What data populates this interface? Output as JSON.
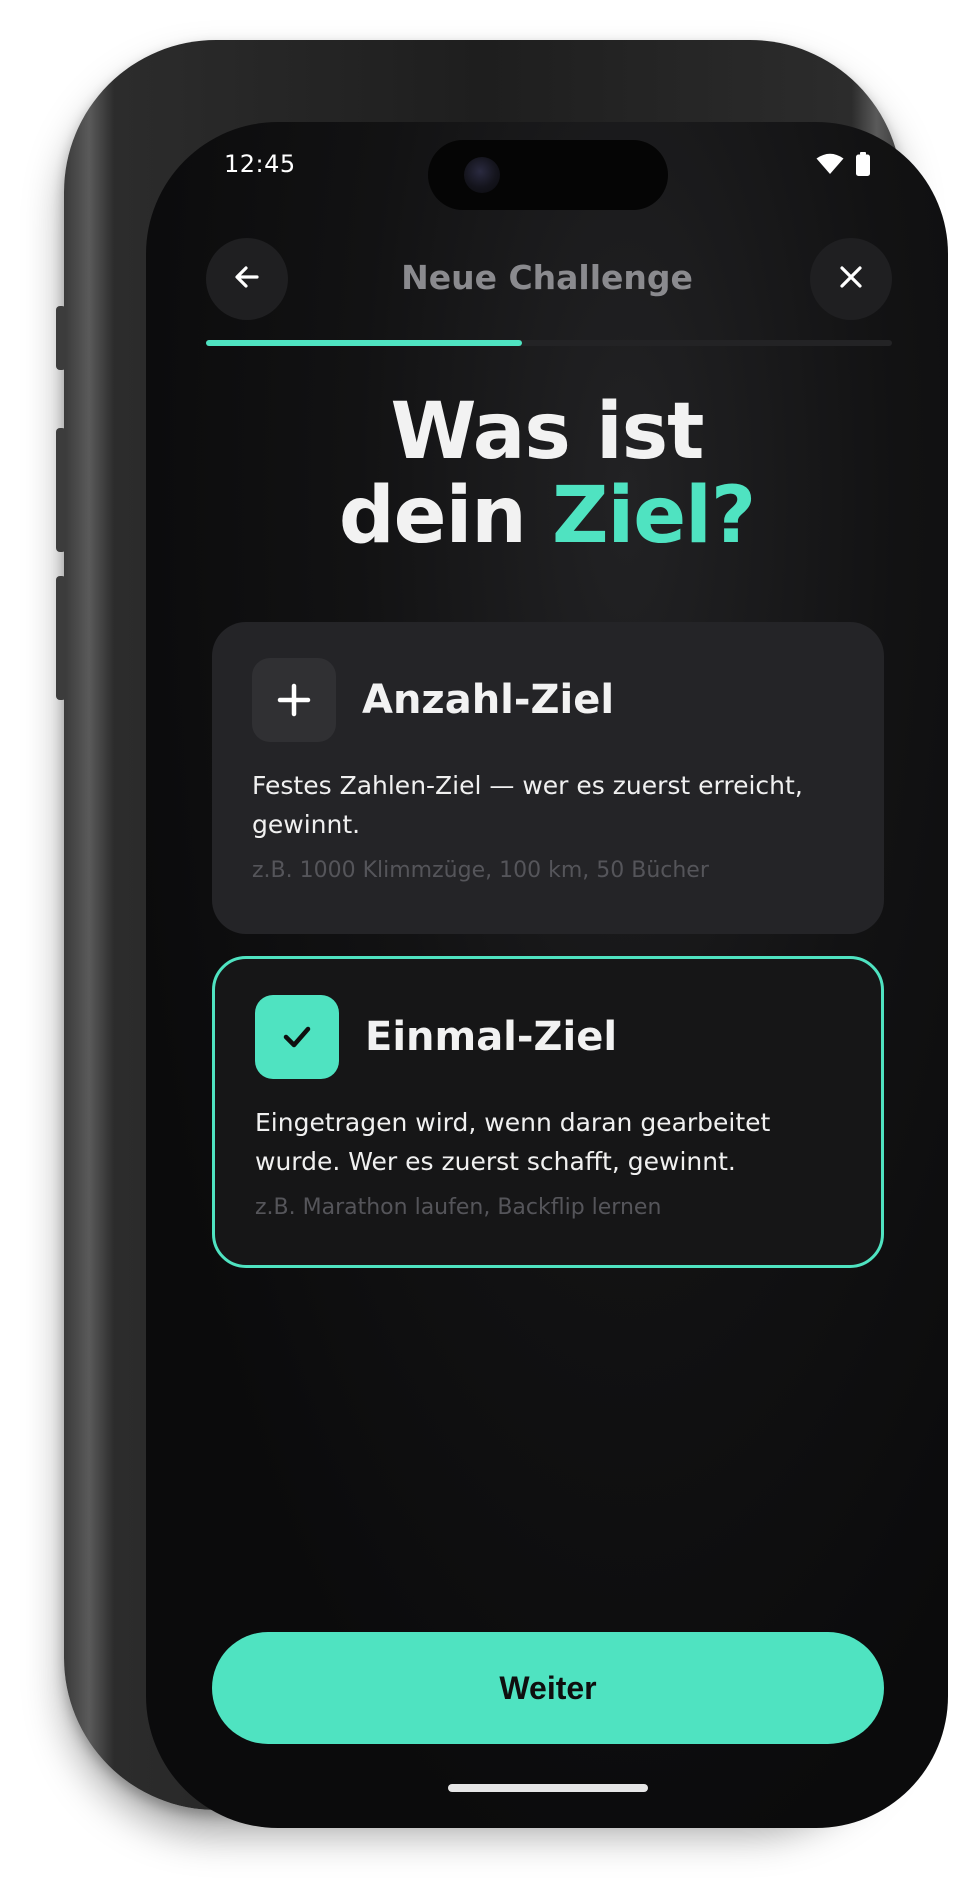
{
  "status_bar": {
    "time": "12:45",
    "wifi_icon": "wifi-icon",
    "battery_icon": "battery-icon"
  },
  "header": {
    "back_icon": "arrow-left-icon",
    "title": "Neue Challenge",
    "close_icon": "close-icon",
    "progress_fraction": 0.46
  },
  "headline": {
    "line1": "Was ist",
    "line2_prefix": "dein ",
    "line2_accent": "Ziel?"
  },
  "options": [
    {
      "icon": "plus-icon",
      "title": "Anzahl-Ziel",
      "description": "Festes Zahlen-Ziel — wer es zuerst erreicht, gewinnt.",
      "example": "z.B. 1000 Klimmzüge, 100 km, 50 Bücher",
      "selected": false
    },
    {
      "icon": "check-icon",
      "title": "Einmal-Ziel",
      "description": "Eingetragen wird, wenn daran gearbeitet wurde. Wer es zuerst schafft, gewinnt.",
      "example": "z.B. Marathon laufen, Backflip lernen",
      "selected": true
    }
  ],
  "cta": {
    "label": "Weiter"
  },
  "colors": {
    "accent": "#4fe3c1",
    "background": "#0b0b0c",
    "card": "#242427"
  }
}
